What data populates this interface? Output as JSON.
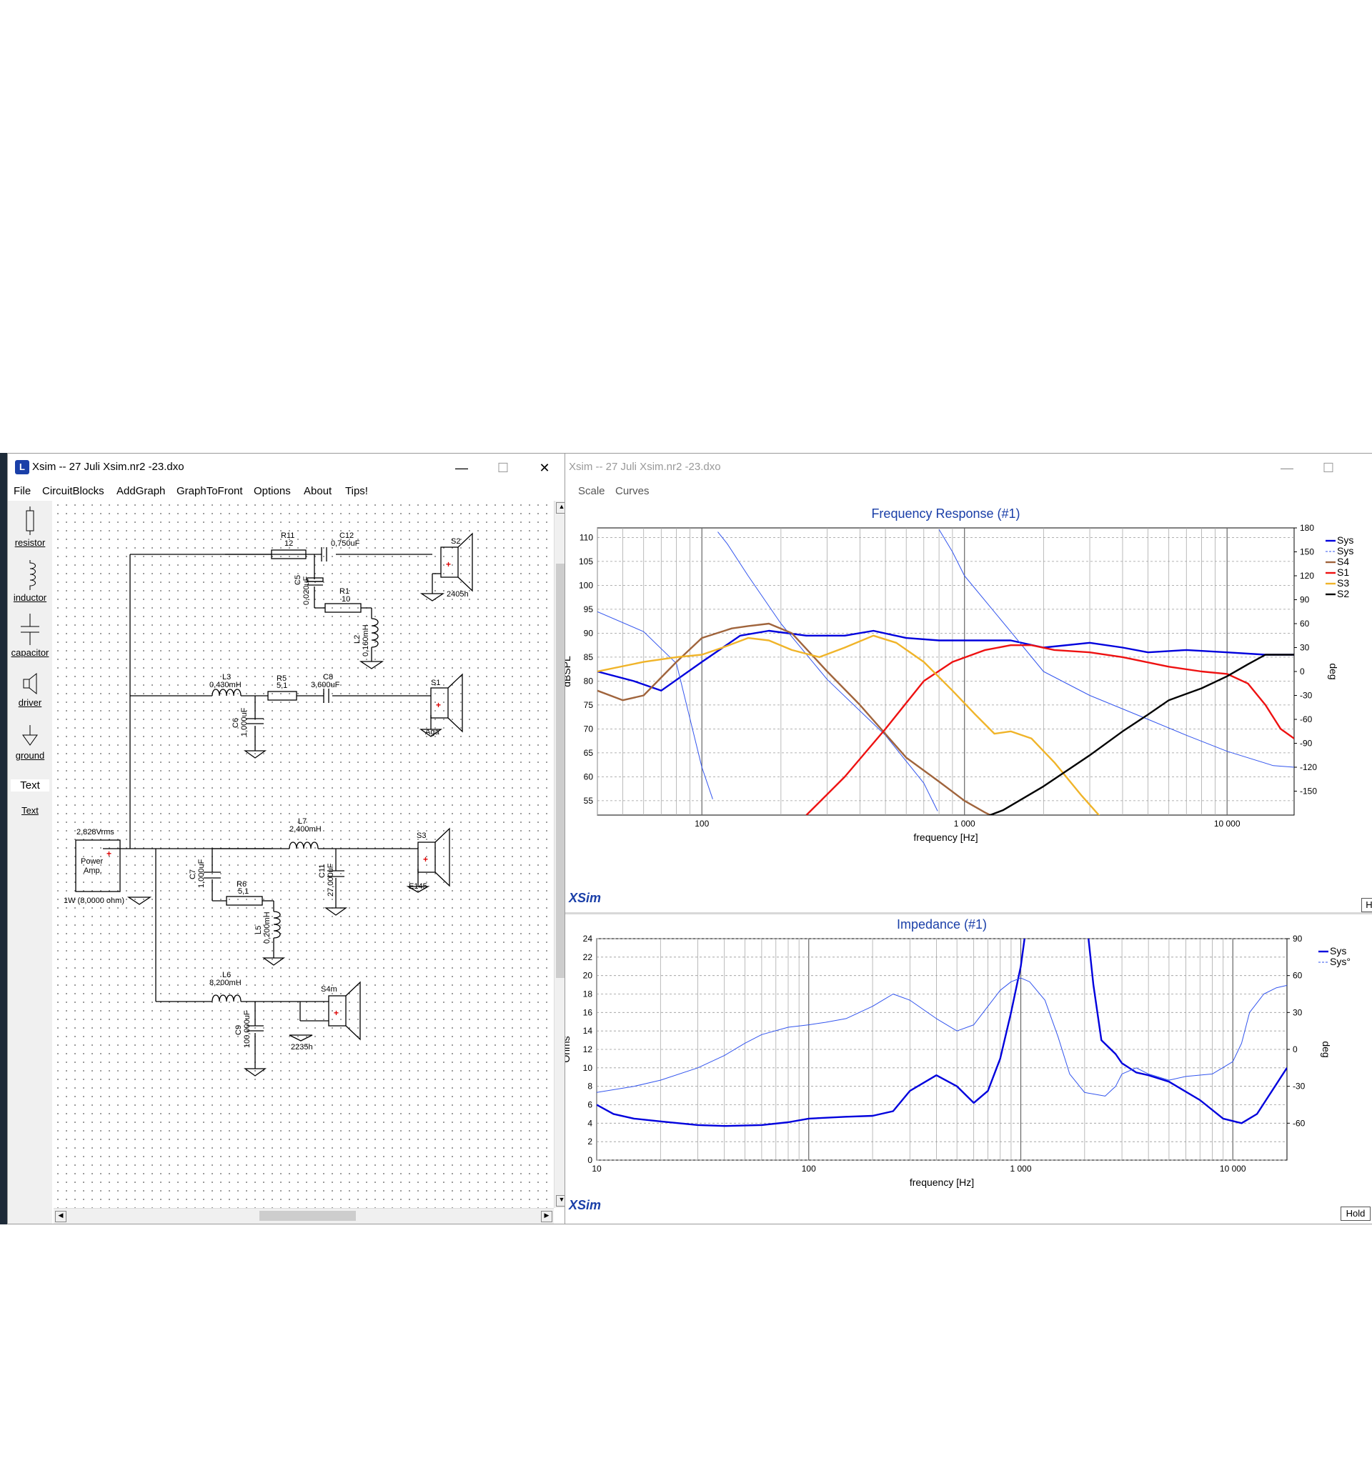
{
  "left_window": {
    "title": "Xsim -- 27 Juli Xsim.nr2 -23.dxo",
    "buttons": {
      "minimize": "—",
      "maximize": "☐",
      "close": "✕"
    },
    "menu": [
      "File",
      "CircuitBlocks",
      "AddGraph",
      "GraphToFront",
      "Options",
      "About",
      "Tips!"
    ],
    "tools": [
      "resistor",
      "inductor",
      "capacitor",
      "driver",
      "ground",
      "Text",
      "Text"
    ]
  },
  "schematic": {
    "labels": {
      "r11": "R11",
      "r11_val": "12",
      "c12": "C12",
      "c12_val": "0,750uF",
      "s2": "S2",
      "c5": "C5",
      "c5_val": "0,020uF",
      "r1": "R1",
      "r1_val": "10",
      "l2": "L2",
      "l2_val": "0,160mH",
      "s2_model": "2405h",
      "l3": "L3",
      "l3_val": "0,430mH",
      "r5": "R5",
      "r5_val": "5,1",
      "c8": "C8",
      "c8_val": "3,600uF",
      "s1": "S1",
      "c6": "C6",
      "c6_val": "1,000uF",
      "s1_model": "Aga",
      "amp_v": "2,828Vrms",
      "amp_l1": "Power",
      "amp_l2": "Amp.",
      "amp_w": "1W (8,0000 ohm)",
      "l7": "L7",
      "l7_val": "2,400mH",
      "s3": "S3",
      "c11": "C11",
      "c11_val": "27,000uF",
      "s3_model": "E145",
      "c7": "C7",
      "c7_val": "1,000uF",
      "r6": "R6",
      "r6_val": "5,1",
      "l5": "L5",
      "l5_val": "0,200mH",
      "l6": "L6",
      "l6_val": "8,200mH",
      "s4": "S4m",
      "c9": "C9",
      "c9_val": "100,000uF",
      "s4_model": "2235h"
    }
  },
  "right_window": {
    "title": "Xsim -- 27 Juli Xsim.nr2 -23.dxo",
    "buttons": {
      "minimize": "—",
      "maximize": "☐"
    },
    "menu": [
      "Scale",
      "Curves"
    ],
    "logo": "XSim",
    "hold_right_fr": "H",
    "hold": "Hold"
  },
  "chart_data": [
    {
      "type": "line",
      "title": "Frequency Response (#1)",
      "xlabel": "frequency [Hz]",
      "ylabel": "dBSPL",
      "y2label": "deg",
      "xscale": "log",
      "xlim": [
        40,
        18000
      ],
      "ylim": [
        52,
        112
      ],
      "y2lim": [
        -180,
        180
      ],
      "x_ticks": [
        "100",
        "1 000",
        "10 000"
      ],
      "y_ticks": [
        "110",
        "105",
        "100",
        "95",
        "90",
        "85",
        "80",
        "75",
        "70",
        "65",
        "60",
        "55"
      ],
      "y2_ticks": [
        "180",
        "150",
        "120",
        "90",
        "60",
        "30",
        "0",
        "-30",
        "-60",
        "-90",
        "-120",
        "-150"
      ],
      "grid": true,
      "legend_position": "right",
      "series": [
        {
          "name": "Sys",
          "color": "#0000dd",
          "style": "solid",
          "x": [
            40,
            55,
            70,
            100,
            140,
            180,
            250,
            350,
            450,
            600,
            800,
            1000,
            1500,
            2000,
            3000,
            4000,
            5000,
            7000,
            10000,
            14000,
            18000
          ],
          "y": [
            82,
            80,
            78,
            84,
            89.5,
            90.5,
            89.5,
            89.5,
            90.5,
            89,
            88.5,
            88.5,
            88.5,
            87,
            88,
            87,
            86,
            86.5,
            86,
            85.5,
            85.5
          ]
        },
        {
          "name": "Sys",
          "color": "#3355ee",
          "style": "dashed",
          "axis": "y2",
          "x": [
            40,
            60,
            80,
            100,
            110,
            115,
            125,
            150,
            200,
            300,
            500,
            700,
            790,
            800,
            900,
            1000,
            1500,
            2000,
            3000,
            5000,
            7000,
            10000,
            15000,
            18000
          ],
          "y": [
            75,
            50,
            10,
            -120,
            -160,
            175,
            160,
            120,
            60,
            -10,
            -80,
            -140,
            -175,
            178,
            150,
            120,
            50,
            0,
            -30,
            -60,
            -80,
            -100,
            -118,
            -120
          ]
        },
        {
          "name": "S4",
          "color": "#a0643c",
          "style": "solid",
          "x": [
            40,
            50,
            60,
            80,
            100,
            130,
            150,
            180,
            220,
            300,
            400,
            600,
            800,
            1000,
            1200,
            1500
          ],
          "y": [
            78,
            76,
            77,
            84,
            89,
            91,
            91.5,
            92,
            90,
            82,
            75,
            64,
            59,
            55,
            52.5,
            50
          ]
        },
        {
          "name": "S1",
          "color": "#ee1111",
          "style": "solid",
          "x": [
            250,
            350,
            500,
            700,
            900,
            1200,
            1500,
            1800,
            2200,
            3000,
            4000,
            6000,
            8000,
            10000,
            12000,
            14000,
            16000,
            18000
          ],
          "y": [
            52,
            60,
            70,
            80,
            84,
            86.5,
            87.5,
            87.5,
            86.5,
            86,
            85,
            83,
            82,
            81.5,
            79.5,
            75,
            70,
            68
          ]
        },
        {
          "name": "S3",
          "color": "#f0b429",
          "style": "solid",
          "x": [
            40,
            60,
            80,
            100,
            120,
            150,
            180,
            220,
            280,
            350,
            450,
            550,
            700,
            900,
            1100,
            1300,
            1500,
            1800,
            2200,
            2800,
            3500,
            4000
          ],
          "y": [
            82,
            84,
            85,
            85.5,
            87,
            89,
            88.5,
            86.5,
            85,
            87,
            89.5,
            88,
            84,
            78,
            73,
            69,
            69.5,
            68,
            63,
            56,
            50,
            48
          ]
        },
        {
          "name": "S2",
          "color": "#000000",
          "style": "solid",
          "x": [
            1000,
            1400,
            2000,
            3000,
            4000,
            5000,
            6000,
            8000,
            10000,
            12000,
            14000,
            16000,
            18000
          ],
          "y": [
            50,
            53,
            58,
            64.5,
            69.5,
            73,
            76,
            78.5,
            81,
            83.5,
            85.5,
            85.5,
            85.5
          ]
        }
      ]
    },
    {
      "type": "line",
      "title": "Impedance (#1)",
      "xlabel": "frequency [Hz]",
      "ylabel": "Ohms",
      "y2label": "deg",
      "xscale": "log",
      "xlim": [
        10,
        18000
      ],
      "ylim": [
        0,
        24
      ],
      "y2lim": [
        -90,
        90
      ],
      "x_ticks": [
        "10",
        "100",
        "1 000",
        "10 000"
      ],
      "y_ticks": [
        "24",
        "22",
        "20",
        "18",
        "16",
        "14",
        "12",
        "10",
        "8",
        "6",
        "4",
        "2",
        "0"
      ],
      "y2_ticks": [
        "90",
        "60",
        "30",
        "0",
        "-30",
        "-60"
      ],
      "grid": true,
      "legend_position": "right",
      "series": [
        {
          "name": "Sys",
          "color": "#0000dd",
          "style": "solid",
          "x": [
            10,
            12,
            15,
            20,
            30,
            40,
            60,
            80,
            100,
            150,
            200,
            250,
            300,
            400,
            500,
            600,
            700,
            800,
            900,
            1000,
            1100,
            1300,
            1600,
            2000,
            2200,
            2400,
            2800,
            3000,
            3500,
            4000,
            5000,
            7000,
            9000,
            11000,
            13000,
            18000
          ],
          "y": [
            6,
            5,
            4.5,
            4.2,
            3.8,
            3.7,
            3.8,
            4.1,
            4.5,
            4.7,
            4.8,
            5.3,
            7.5,
            9.2,
            8,
            6.2,
            7.5,
            11,
            16,
            21,
            28,
            30,
            30,
            28,
            19,
            13,
            11.5,
            10.5,
            9.5,
            9.2,
            8.5,
            6.5,
            4.5,
            4,
            5,
            10
          ]
        },
        {
          "name": "Sys°",
          "color": "#3355ee",
          "style": "dashed",
          "axis": "y2",
          "x": [
            10,
            15,
            20,
            30,
            40,
            50,
            60,
            80,
            100,
            120,
            150,
            200,
            250,
            300,
            400,
            500,
            600,
            700,
            800,
            900,
            1000,
            1100,
            1300,
            1500,
            1700,
            2000,
            2500,
            2800,
            3000,
            3500,
            4000,
            5000,
            6000,
            8000,
            10000,
            11000,
            12000,
            14000,
            16000,
            18000
          ],
          "y": [
            -35,
            -30,
            -25,
            -15,
            -5,
            5,
            12,
            18,
            20,
            22,
            25,
            35,
            45,
            40,
            25,
            15,
            20,
            35,
            48,
            55,
            58,
            55,
            40,
            10,
            -20,
            -35,
            -38,
            -30,
            -20,
            -15,
            -20,
            -25,
            -22,
            -20,
            -10,
            5,
            30,
            45,
            50,
            52
          ]
        }
      ]
    }
  ]
}
